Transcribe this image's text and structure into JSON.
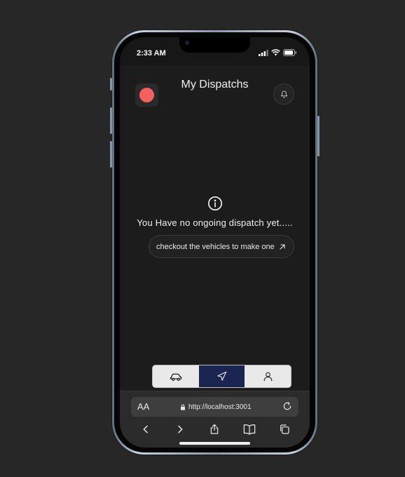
{
  "status_bar": {
    "time": "2:33 AM"
  },
  "header": {
    "title": "My Dispatchs"
  },
  "empty_state": {
    "message": "You Have no ongoing dispatch yet.....",
    "cta_label": "checkout the vehicles to make one"
  },
  "bottom_nav": {
    "items": [
      {
        "icon": "car-icon",
        "active": false
      },
      {
        "icon": "navigation-arrow-icon",
        "active": true
      },
      {
        "icon": "user-icon",
        "active": false
      }
    ]
  },
  "browser": {
    "text_size_label": "AA",
    "url": "http://localhost:3001"
  },
  "colors": {
    "logo": "#f26060",
    "active_nav": "#1a2650",
    "background": "#1c1c1c"
  }
}
